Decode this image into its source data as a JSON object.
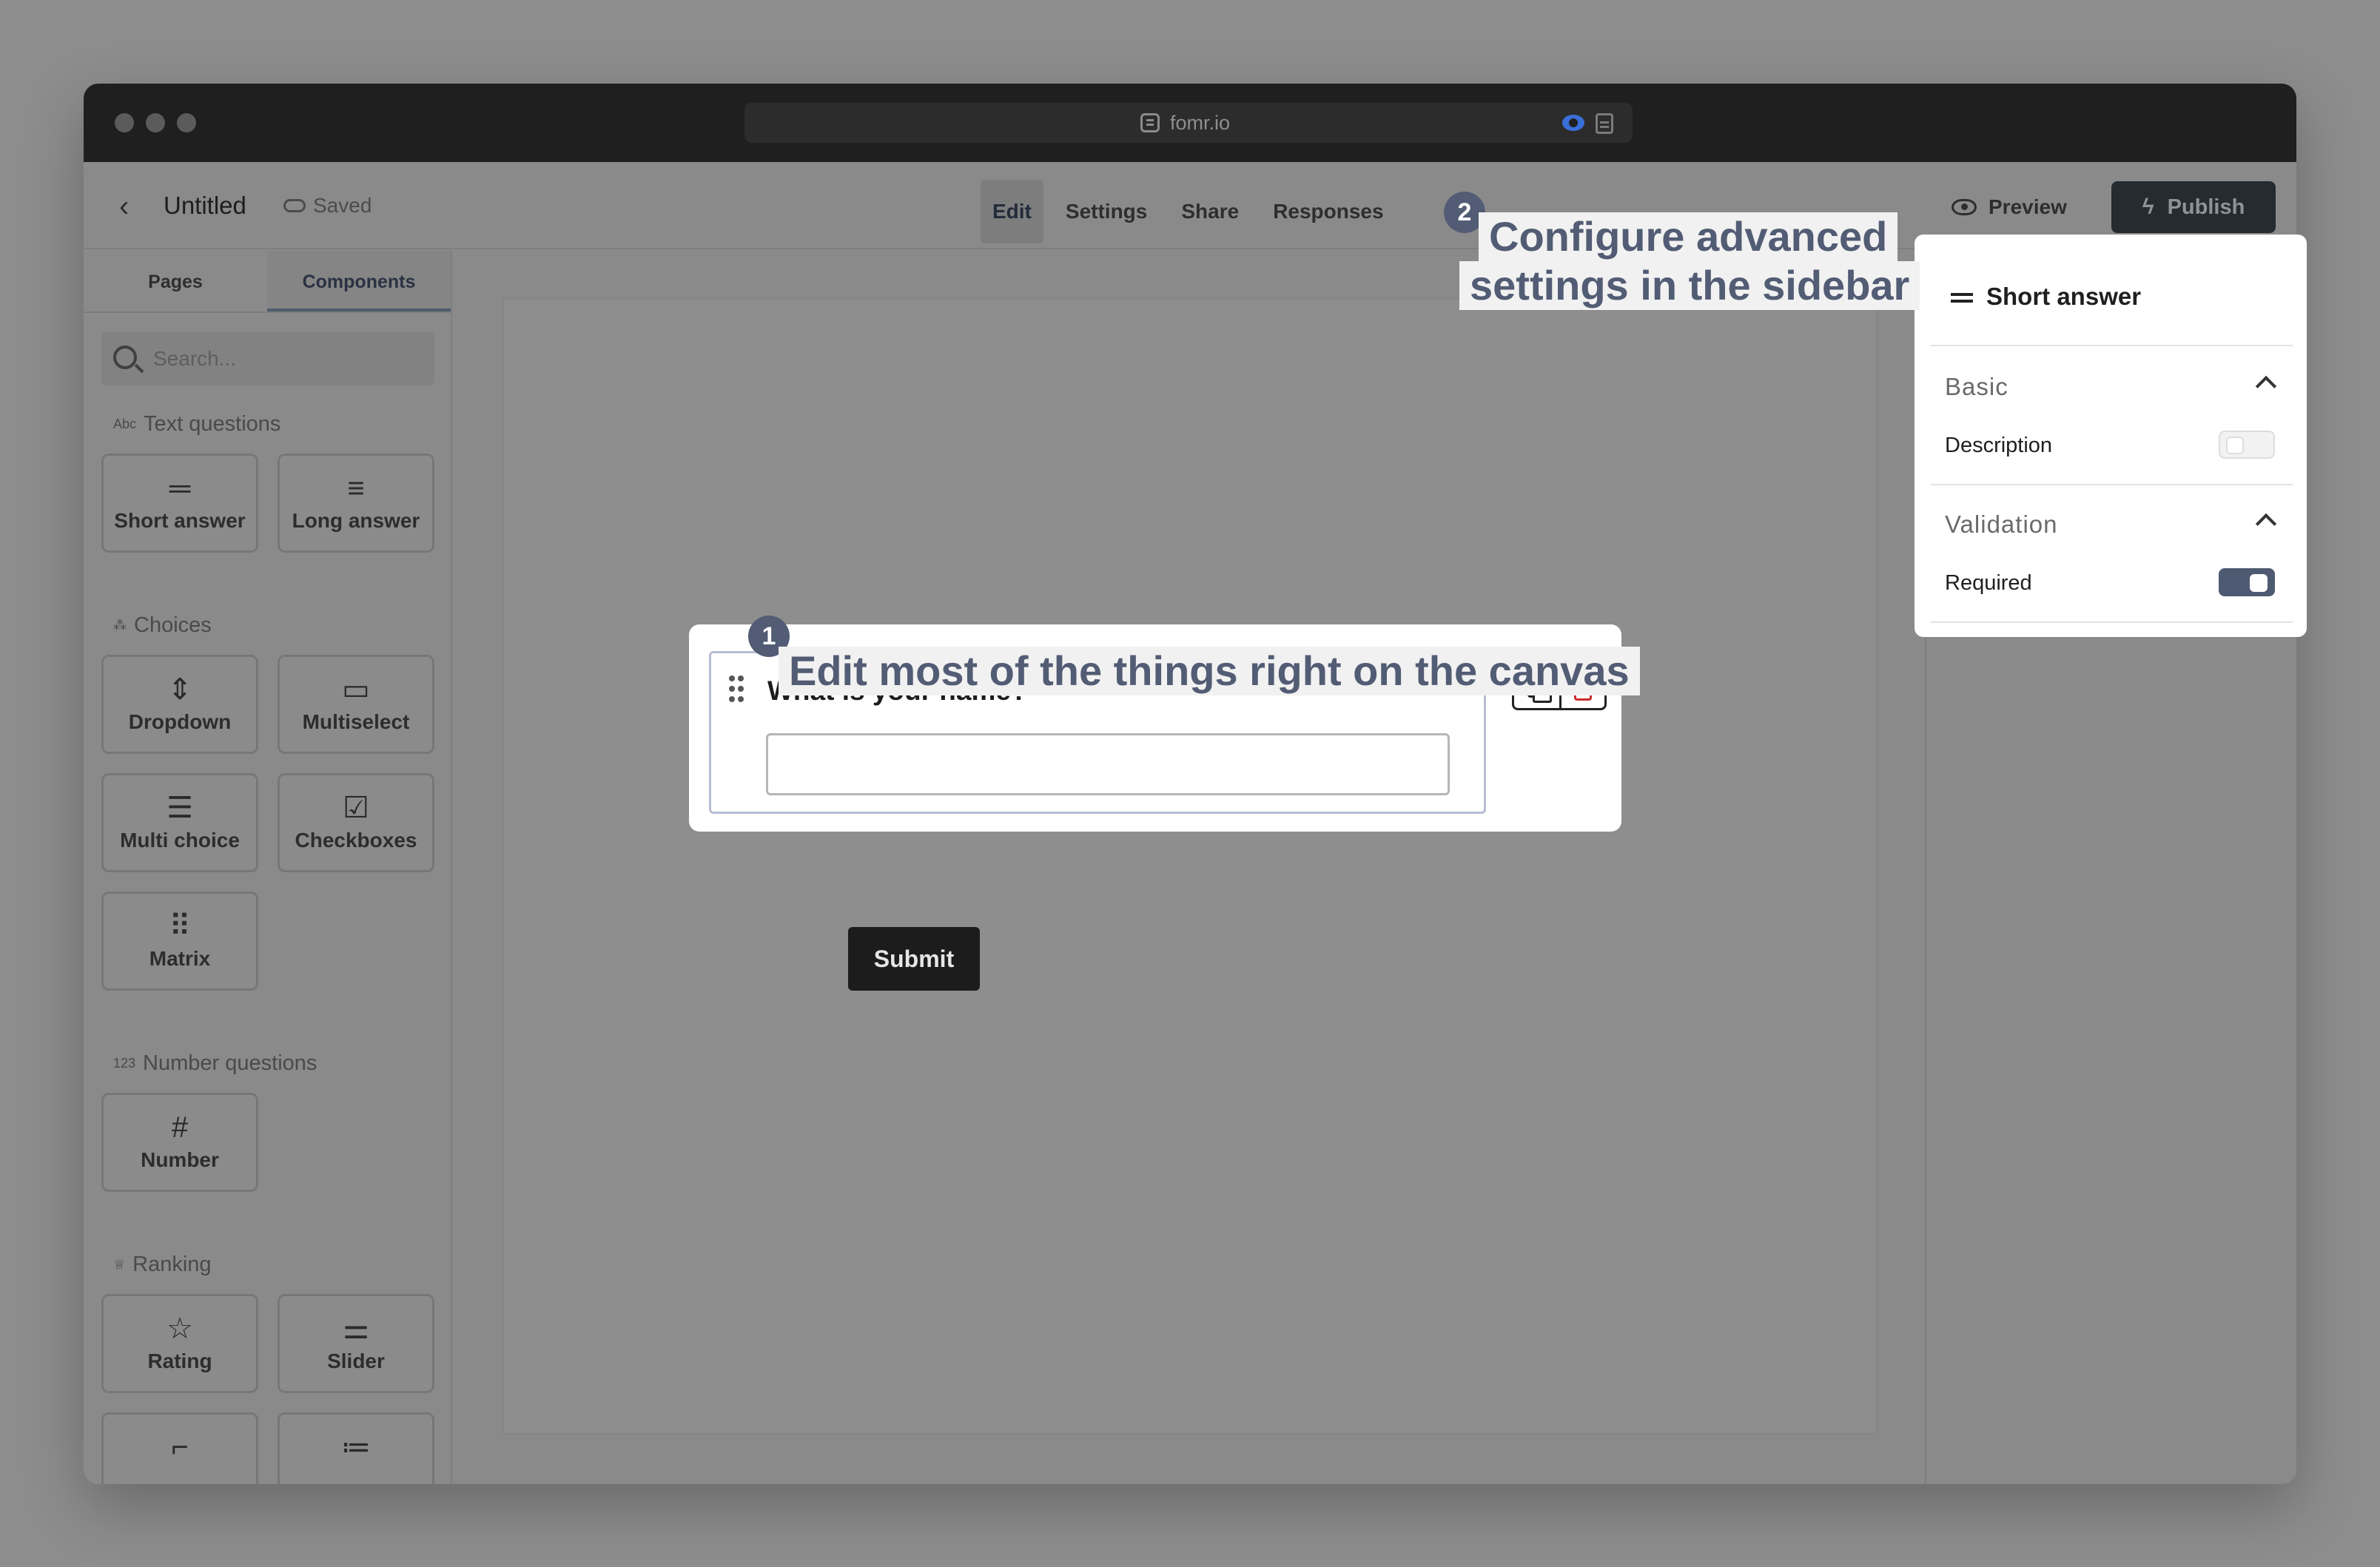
{
  "browser": {
    "url": "fomr.io"
  },
  "header": {
    "title": "Untitled",
    "saved_label": "Saved",
    "tabs": [
      {
        "label": "Edit",
        "active": true
      },
      {
        "label": "Settings",
        "active": false
      },
      {
        "label": "Share",
        "active": false
      },
      {
        "label": "Responses",
        "active": false
      }
    ],
    "preview_label": "Preview",
    "publish_label": "Publish"
  },
  "sidebar": {
    "tabs": [
      {
        "label": "Pages",
        "active": false
      },
      {
        "label": "Components",
        "active": true
      }
    ],
    "search_placeholder": "Search...",
    "sections": {
      "text": {
        "label": "Text questions",
        "items": [
          {
            "label": "Short answer",
            "icon": "short-answer-icon"
          },
          {
            "label": "Long answer",
            "icon": "long-answer-icon"
          }
        ]
      },
      "choices": {
        "label": "Choices",
        "items": [
          {
            "label": "Dropdown",
            "icon": "dropdown-icon"
          },
          {
            "label": "Multiselect",
            "icon": "multiselect-icon"
          },
          {
            "label": "Multi choice",
            "icon": "multi-choice-icon"
          },
          {
            "label": "Checkboxes",
            "icon": "checkboxes-icon"
          },
          {
            "label": "Matrix",
            "icon": "matrix-icon"
          }
        ]
      },
      "number": {
        "label": "Number questions",
        "items": [
          {
            "label": "Number",
            "icon": "hash-icon"
          }
        ]
      },
      "ranking": {
        "label": "Ranking",
        "items": [
          {
            "label": "Rating",
            "icon": "star-icon"
          },
          {
            "label": "Slider",
            "icon": "slider-icon"
          }
        ]
      }
    }
  },
  "canvas": {
    "question": {
      "text": "What is your name?",
      "required_mark": "*"
    },
    "submit_label": "Submit"
  },
  "right_panel": {
    "title": "Short answer",
    "basic": {
      "heading": "Basic",
      "description_label": "Description",
      "description_enabled": false
    },
    "validation": {
      "heading": "Validation",
      "required_label": "Required",
      "required_enabled": true
    }
  },
  "callouts": [
    {
      "number": "1",
      "text": "Edit most of the things right on the canvas"
    },
    {
      "number": "2",
      "line1": "Configure advanced",
      "line2": "settings in the sidebar"
    }
  ],
  "colors": {
    "accent": "#525c74",
    "publish_bg": "#252b30",
    "delete_red": "#cc2b2b"
  }
}
